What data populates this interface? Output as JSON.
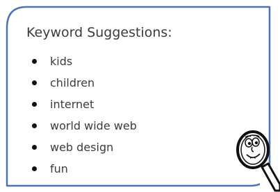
{
  "panel": {
    "heading": "Keyword Suggestions:",
    "border_color": "#4a72b8",
    "keywords": [
      {
        "label": "kids"
      },
      {
        "label": "children"
      },
      {
        "label": "internet"
      },
      {
        "label": "world wide web"
      },
      {
        "label": "web design"
      },
      {
        "label": "fun"
      }
    ]
  },
  "icons": {
    "mascot": "magnifying-glass-character-icon"
  }
}
